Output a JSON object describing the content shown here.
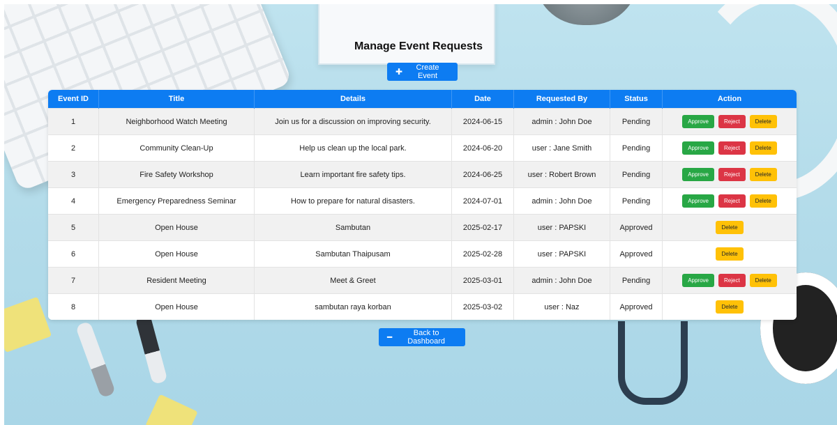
{
  "page": {
    "title": "Manage Event Requests",
    "create_label": "Create Event",
    "create_icon": "plus-icon",
    "back_label": "Back to Dashboard",
    "back_icon": "minus-icon",
    "accent_color": "#0d7cf2"
  },
  "table": {
    "headers": {
      "id": "Event ID",
      "title": "Title",
      "details": "Details",
      "date": "Date",
      "requested_by": "Requested By",
      "status": "Status",
      "action": "Action"
    },
    "actions": {
      "approve": "Approve",
      "reject": "Reject",
      "delete": "Delete"
    },
    "rows": [
      {
        "id": "1",
        "title": "Neighborhood Watch Meeting",
        "details": "Join us for a discussion on improving security.",
        "date": "2024-06-15",
        "requested_by": "admin : John Doe",
        "status": "Pending"
      },
      {
        "id": "2",
        "title": "Community Clean-Up",
        "details": "Help us clean up the local park.",
        "date": "2024-06-20",
        "requested_by": "user : Jane Smith",
        "status": "Pending"
      },
      {
        "id": "3",
        "title": "Fire Safety Workshop",
        "details": "Learn important fire safety tips.",
        "date": "2024-06-25",
        "requested_by": "user : Robert Brown",
        "status": "Pending"
      },
      {
        "id": "4",
        "title": "Emergency Preparedness Seminar",
        "details": "How to prepare for natural disasters.",
        "date": "2024-07-01",
        "requested_by": "admin : John Doe",
        "status": "Pending"
      },
      {
        "id": "5",
        "title": "Open House",
        "details": "Sambutan",
        "date": "2025-02-17",
        "requested_by": "user : PAPSKI",
        "status": "Approved"
      },
      {
        "id": "6",
        "title": "Open House",
        "details": "Sambutan Thaipusam",
        "date": "2025-02-28",
        "requested_by": "user : PAPSKI",
        "status": "Approved"
      },
      {
        "id": "7",
        "title": "Resident Meeting",
        "details": "Meet & Greet",
        "date": "2025-03-01",
        "requested_by": "admin : John Doe",
        "status": "Pending"
      },
      {
        "id": "8",
        "title": "Open House",
        "details": "sambutan raya korban",
        "date": "2025-03-02",
        "requested_by": "user : Naz",
        "status": "Approved"
      }
    ]
  }
}
